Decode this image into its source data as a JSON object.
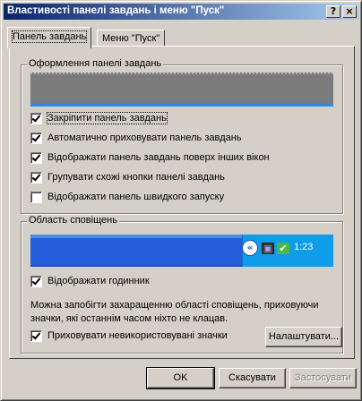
{
  "window": {
    "title": "Властивості панелі завдань і меню \"Пуск\"",
    "help_button": "?",
    "close_button": "×"
  },
  "tabs": [
    {
      "label": "Панель завдань",
      "active": true
    },
    {
      "label": "Меню \"Пуск\"",
      "active": false
    }
  ],
  "taskbar_group": {
    "title": "Оформлення панелі завдань",
    "options": [
      {
        "label": "Закріпити панель завдань",
        "checked": true
      },
      {
        "label": "Автоматично приховувати панель завдань",
        "checked": true
      },
      {
        "label": "Відображати панель завдань поверх інших вікон",
        "checked": true
      },
      {
        "label": "Групувати схожі кнопки панелі завдань",
        "checked": true
      },
      {
        "label": "Відображати панель швидкого запуску",
        "checked": false
      }
    ]
  },
  "notification_group": {
    "title": "Область сповіщень",
    "preview": {
      "chevron": "«",
      "clock": "1:23"
    },
    "show_clock": {
      "label": "Відображати годинник",
      "checked": true
    },
    "info": "Можна запобігти захаращенню області сповіщень, приховуючи значки, які останнім часом ніхто не клацав.",
    "hide_icons": {
      "label": "Приховувати невикористовувані значки",
      "checked": true
    },
    "customize_button": "Налаштувати..."
  },
  "buttons": {
    "ok": "OK",
    "cancel": "Скасувати",
    "apply": "Застосувати"
  },
  "colors": {
    "titlebar_start": "#0a246a",
    "titlebar_end": "#a6caf0",
    "dialog_face": "#d4d0c8",
    "taskbar_blue": "#245edb",
    "tray_blue": "#0f9ce8"
  }
}
